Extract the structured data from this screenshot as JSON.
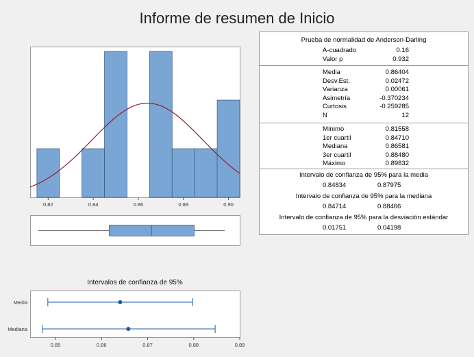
{
  "title": "Informe de resumen de Inicio",
  "stats": {
    "ad_heading": "Prueba de normalidad de Anderson-Darling",
    "ad_rows": [
      {
        "label": "A-cuadrado",
        "value": "0.16"
      },
      {
        "label": "Valor p",
        "value": "0.932"
      }
    ],
    "moment_rows": [
      {
        "label": "Media",
        "value": "0.86404"
      },
      {
        "label": "Desv.Est.",
        "value": "0.02472"
      },
      {
        "label": "Varianza",
        "value": "0.00061"
      },
      {
        "label": "Asimetría",
        "value": "-0.370234"
      },
      {
        "label": "Curtosis",
        "value": "-0.259285"
      },
      {
        "label": "N",
        "value": "12"
      }
    ],
    "quantile_rows": [
      {
        "label": "Mínimo",
        "value": "0.81558"
      },
      {
        "label": "1er cuartil",
        "value": "0.84710"
      },
      {
        "label": "Mediana",
        "value": "0.86581"
      },
      {
        "label": "3er cuartil",
        "value": "0.88480"
      },
      {
        "label": "Máximo",
        "value": "0.89832"
      }
    ],
    "ci_mean_heading": "Intervalo de confianza de 95% para la media",
    "ci_mean": [
      "0.84834",
      "0.87975"
    ],
    "ci_median_heading": "Intervalo de confianza de 95% para la mediana",
    "ci_median": [
      "0.84714",
      "0.88466"
    ],
    "ci_sd_heading": "Intervalo de confianza de 95% para la desviación estándar",
    "ci_sd": [
      "0.01751",
      "0.04198"
    ]
  },
  "colors": {
    "bar_fill": "#7aa6d6",
    "bar_stroke": "#3f6186",
    "normal_curve": "#9b1b2c",
    "ci_line": "#1f5aa0",
    "ci_point": "#1f5aa0",
    "background": "#f0f0f0",
    "panel": "#ffffff"
  },
  "chart_data": [
    {
      "type": "bar",
      "subtype": "histogram",
      "bin_width": 0.01,
      "bin_starts": [
        0.815,
        0.825,
        0.835,
        0.845,
        0.855,
        0.865,
        0.875,
        0.885,
        0.895
      ],
      "values": [
        1,
        0,
        1,
        3,
        0,
        3,
        1,
        1,
        2
      ],
      "xlim": [
        0.812,
        0.905
      ],
      "ylim": [
        0,
        3.1
      ],
      "xticks": [
        "0.82",
        "0.84",
        "0.86",
        "0.88",
        "0.90"
      ],
      "xtick_values": [
        0.82,
        0.84,
        0.86,
        0.88,
        0.9
      ],
      "normal_curve": {
        "mean": 0.86404,
        "sd": 0.02472,
        "n": 12
      }
    },
    {
      "type": "boxplot",
      "min": 0.81558,
      "q1": 0.8471,
      "median": 0.86581,
      "q3": 0.8848,
      "max": 0.89832,
      "xlim": [
        0.812,
        0.905
      ]
    },
    {
      "type": "interval",
      "title": "Intervalos de confianza de 95%",
      "categories": [
        "Media",
        "Mediana"
      ],
      "estimates": [
        0.86404,
        0.86581
      ],
      "lower": [
        0.84834,
        0.84714
      ],
      "upper": [
        0.87975,
        0.88466
      ],
      "xlim": [
        0.8445,
        0.89
      ],
      "xticks": [
        "0.85",
        "0.86",
        "0.87",
        "0.88",
        "0.89"
      ],
      "xtick_values": [
        0.85,
        0.86,
        0.87,
        0.88,
        0.89
      ]
    }
  ]
}
